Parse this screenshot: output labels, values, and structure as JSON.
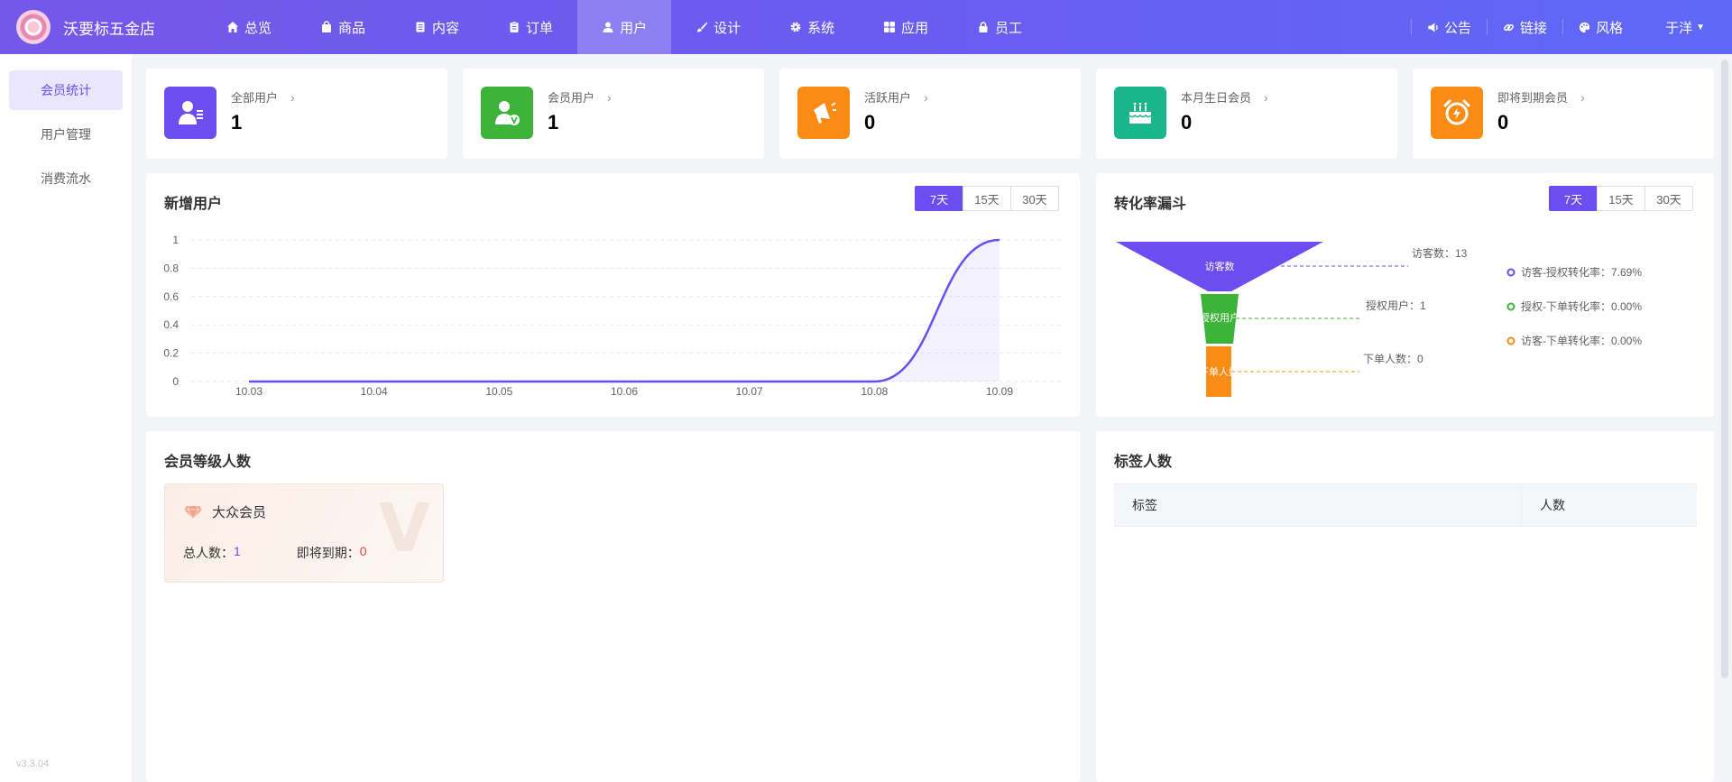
{
  "app": {
    "store_name": "沃要标五金店",
    "version": "v3.3.04"
  },
  "nav": {
    "items": [
      {
        "label": "总览",
        "icon": "home-icon"
      },
      {
        "label": "商品",
        "icon": "bag-icon"
      },
      {
        "label": "内容",
        "icon": "document-icon"
      },
      {
        "label": "订单",
        "icon": "clipboard-icon"
      },
      {
        "label": "用户",
        "icon": "user-icon"
      },
      {
        "label": "设计",
        "icon": "brush-icon"
      },
      {
        "label": "系统",
        "icon": "gear-icon"
      },
      {
        "label": "应用",
        "icon": "grid-icon"
      },
      {
        "label": "员工",
        "icon": "lock-icon"
      }
    ],
    "active": "用户"
  },
  "top_right": {
    "notice": "公告",
    "link": "链接",
    "style": "风格",
    "user": "于洋"
  },
  "sidebar": {
    "items": [
      {
        "label": "会员统计"
      },
      {
        "label": "用户管理"
      },
      {
        "label": "消费流水"
      }
    ],
    "active": "会员统计"
  },
  "stats": [
    {
      "label": "全部用户",
      "value": "1",
      "color": "#6b4df0",
      "icon": "user-list-icon"
    },
    {
      "label": "会员用户",
      "value": "1",
      "color": "#3db33a",
      "icon": "vip-user-icon"
    },
    {
      "label": "活跃用户",
      "value": "0",
      "color": "#fa8c16",
      "icon": "megaphone-icon"
    },
    {
      "label": "本月生日会员",
      "value": "0",
      "color": "#1ab58a",
      "icon": "cake-icon"
    },
    {
      "label": "即将到期会员",
      "value": "0",
      "color": "#fa8c16",
      "icon": "alarm-clock-icon"
    }
  ],
  "new_users": {
    "title": "新增用户",
    "ranges": [
      "7天",
      "15天",
      "30天"
    ],
    "active_range": "7天"
  },
  "funnel": {
    "title": "转化率漏斗",
    "ranges": [
      "7天",
      "15天",
      "30天"
    ],
    "active_range": "7天",
    "stages": [
      {
        "label": "访客数",
        "callout": "访客数：13",
        "color": "#6b4df0"
      },
      {
        "label": "授权用户",
        "callout": "授权用户：1",
        "color": "#3db33a"
      },
      {
        "label": "下单人数",
        "callout": "下单人数：0",
        "color": "#fa8c16"
      }
    ],
    "legend": [
      {
        "label": "访客-授权转化率：7.69%",
        "color": "#6b4df0"
      },
      {
        "label": "授权-下单转化率：0.00%",
        "color": "#3db33a"
      },
      {
        "label": "访客-下单转化率：0.00%",
        "color": "#fa8c16"
      }
    ]
  },
  "member_levels": {
    "title": "会员等级人数",
    "cards": [
      {
        "name": "大众会员",
        "total_label": "总人数：",
        "total": "1",
        "expiring_label": "即将到期：",
        "expiring": "0"
      }
    ]
  },
  "tags": {
    "title": "标签人数",
    "columns": [
      "标签",
      "人数"
    ]
  },
  "chart_data": {
    "type": "area",
    "categories": [
      "10.03",
      "10.04",
      "10.05",
      "10.06",
      "10.07",
      "10.08",
      "10.09"
    ],
    "series": [
      {
        "values": [
          0,
          0,
          0,
          0,
          0,
          0,
          1
        ],
        "color": "#6b4df0"
      }
    ],
    "ylim": [
      0,
      1
    ],
    "yticks": [
      "0",
      "0.2",
      "0.4",
      "0.6",
      "0.8",
      "1"
    ],
    "grid": true,
    "smooth": true
  }
}
